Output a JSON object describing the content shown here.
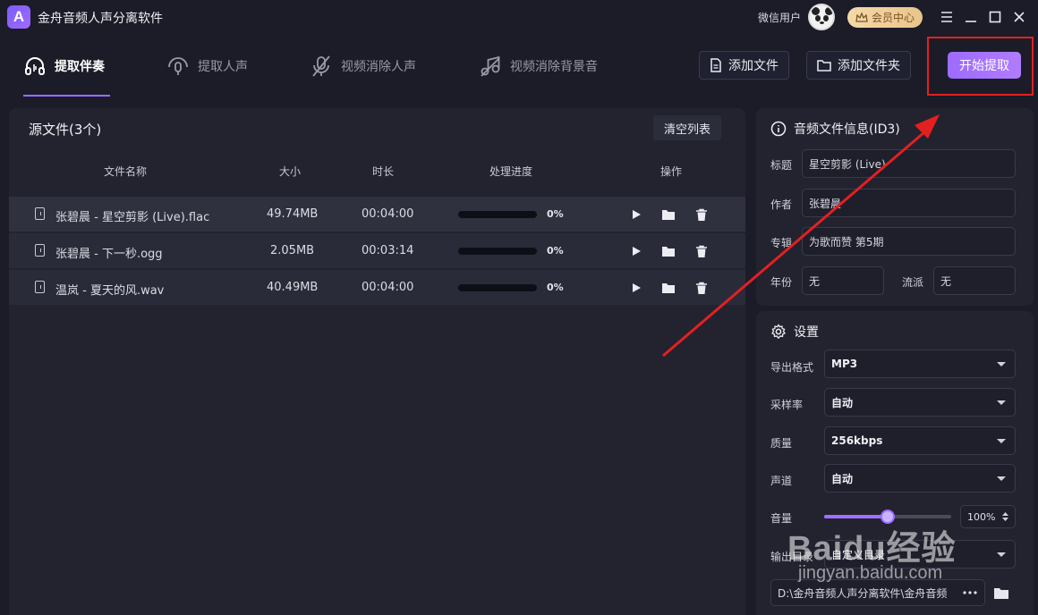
{
  "app": {
    "title": "金舟音频人声分离软件",
    "user_name": "微信用户",
    "vip_label": "会员中心"
  },
  "tabs": [
    {
      "label": "提取伴奏",
      "active": true
    },
    {
      "label": "提取人声",
      "active": false
    },
    {
      "label": "视频消除人声",
      "active": false
    },
    {
      "label": "视频消除背景音",
      "active": false
    }
  ],
  "toolbar": {
    "add_file": "添加文件",
    "add_folder": "添加文件夹",
    "start": "开始提取"
  },
  "file_list": {
    "title": "源文件(3个)",
    "clear_label": "清空列表",
    "headers": {
      "name": "文件名称",
      "size": "大小",
      "duration": "时长",
      "progress": "处理进度",
      "actions": "操作"
    },
    "rows": [
      {
        "name": "张碧晨 - 星空剪影 (Live).flac",
        "size": "49.74MB",
        "duration": "00:04:00",
        "progress": "0%"
      },
      {
        "name": "张碧晨 - 下一秒.ogg",
        "size": "2.05MB",
        "duration": "00:03:14",
        "progress": "0%"
      },
      {
        "name": "温岚 - 夏天的风.wav",
        "size": "40.49MB",
        "duration": "00:04:00",
        "progress": "0%"
      }
    ]
  },
  "info": {
    "title": "音频文件信息(ID3)",
    "fields": {
      "title_label": "标题",
      "title_value": "星空剪影 (Live)",
      "author_label": "作者",
      "author_value": "张碧晨",
      "album_label": "专辑",
      "album_value": "为歌而赞 第5期",
      "year_label": "年份",
      "year_value": "无",
      "genre_label": "流派",
      "genre_value": "无"
    }
  },
  "settings": {
    "title": "设置",
    "format_label": "导出格式",
    "format_value": "MP3",
    "sample_label": "采样率",
    "sample_value": "自动",
    "quality_label": "质量",
    "quality_value": "256kbps",
    "channel_label": "声道",
    "channel_value": "自动",
    "volume_label": "音量",
    "volume_value": "100%",
    "volume_level": 0.5,
    "output_label": "输出目录",
    "output_value": "自定义目录",
    "path_value": "D:\\金舟音频人声分离软件\\金舟音频"
  },
  "watermark": {
    "main": "Baidu经验",
    "sub": "jingyan.baidu.com"
  },
  "colors": {
    "accent": "#9c6cff",
    "highlight": "#e32020"
  }
}
